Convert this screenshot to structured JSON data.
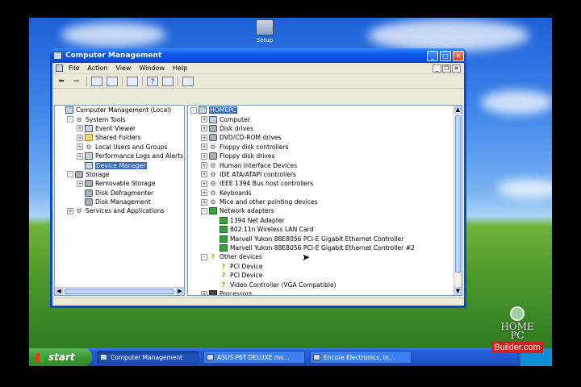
{
  "desktop": {
    "icon_label": "Setup"
  },
  "window": {
    "title": "Computer Management",
    "menu": [
      "File",
      "Action",
      "View",
      "Window",
      "Help"
    ]
  },
  "left_tree": [
    {
      "label": "Computer Management (Local)",
      "level": 0,
      "expander": "none",
      "icon": "computer-icon"
    },
    {
      "label": "System Tools",
      "level": 1,
      "expander": "-",
      "icon": "tools-icon"
    },
    {
      "label": "Event Viewer",
      "level": 2,
      "expander": "+",
      "icon": "event-viewer-icon"
    },
    {
      "label": "Shared Folders",
      "level": 2,
      "expander": "+",
      "icon": "folder-icon"
    },
    {
      "label": "Local Users and Groups",
      "level": 2,
      "expander": "+",
      "icon": "users-icon"
    },
    {
      "label": "Performance Logs and Alerts",
      "level": 2,
      "expander": "+",
      "icon": "performance-icon"
    },
    {
      "label": "Device Manager",
      "level": 2,
      "expander": "none",
      "icon": "device-manager-icon",
      "selected": true
    },
    {
      "label": "Storage",
      "level": 1,
      "expander": "-",
      "icon": "storage-icon"
    },
    {
      "label": "Removable Storage",
      "level": 2,
      "expander": "+",
      "icon": "removable-storage-icon"
    },
    {
      "label": "Disk Defragmenter",
      "level": 2,
      "expander": "none",
      "icon": "defrag-icon"
    },
    {
      "label": "Disk Management",
      "level": 2,
      "expander": "none",
      "icon": "disk-management-icon"
    },
    {
      "label": "Services and Applications",
      "level": 1,
      "expander": "+",
      "icon": "services-icon"
    }
  ],
  "right_tree": [
    {
      "label": "HOMEPC",
      "level": 0,
      "expander": "-",
      "icon": "computer-icon",
      "highlight": true
    },
    {
      "label": "Computer",
      "level": 1,
      "expander": "+",
      "icon": "computer-icon"
    },
    {
      "label": "Disk drives",
      "level": 1,
      "expander": "+",
      "icon": "disk-icon"
    },
    {
      "label": "DVD/CD-ROM drives",
      "level": 1,
      "expander": "+",
      "icon": "dvd-icon"
    },
    {
      "label": "Floppy disk controllers",
      "level": 1,
      "expander": "+",
      "icon": "controller-icon"
    },
    {
      "label": "Floppy disk drives",
      "level": 1,
      "expander": "+",
      "icon": "floppy-icon"
    },
    {
      "label": "Human Interface Devices",
      "level": 1,
      "expander": "+",
      "icon": "hid-icon"
    },
    {
      "label": "IDE ATA/ATAPI controllers",
      "level": 1,
      "expander": "+",
      "icon": "controller-icon"
    },
    {
      "label": "IEEE 1394 Bus host controllers",
      "level": 1,
      "expander": "+",
      "icon": "controller-icon"
    },
    {
      "label": "Keyboards",
      "level": 1,
      "expander": "+",
      "icon": "keyboard-icon"
    },
    {
      "label": "Mice and other pointing devices",
      "level": 1,
      "expander": "+",
      "icon": "mouse-icon"
    },
    {
      "label": "Network adapters",
      "level": 1,
      "expander": "-",
      "icon": "network-icon"
    },
    {
      "label": "1394 Net Adapter",
      "level": 2,
      "expander": "none",
      "icon": "network-icon"
    },
    {
      "label": "802.11n Wireless LAN Card",
      "level": 2,
      "expander": "none",
      "icon": "network-icon"
    },
    {
      "label": "Marvell Yukon 88E8056 PCI-E Gigabit Ethernet Controller",
      "level": 2,
      "expander": "none",
      "icon": "network-icon"
    },
    {
      "label": "Marvell Yukon 88E8056 PCI-E Gigabit Ethernet Controller #2",
      "level": 2,
      "expander": "none",
      "icon": "network-icon"
    },
    {
      "label": "Other devices",
      "level": 1,
      "expander": "-",
      "icon": "unknown-device-icon"
    },
    {
      "label": "PCI Device",
      "level": 2,
      "expander": "none",
      "icon": "warning-icon"
    },
    {
      "label": "PCI Device",
      "level": 2,
      "expander": "none",
      "icon": "warning-icon"
    },
    {
      "label": "Video Controller (VGA Compatible)",
      "level": 2,
      "expander": "none",
      "icon": "warning-icon"
    },
    {
      "label": "Processors",
      "level": 1,
      "expander": "+",
      "icon": "processor-icon"
    }
  ],
  "taskbar": {
    "start_label": "start",
    "tasks": [
      "Computer Management",
      "ASUS P6T DELUXE mo...",
      "Encore Electronics, In..."
    ]
  },
  "watermark": {
    "line1": "HOME",
    "line2": "PC",
    "line3": "Builder.com"
  }
}
